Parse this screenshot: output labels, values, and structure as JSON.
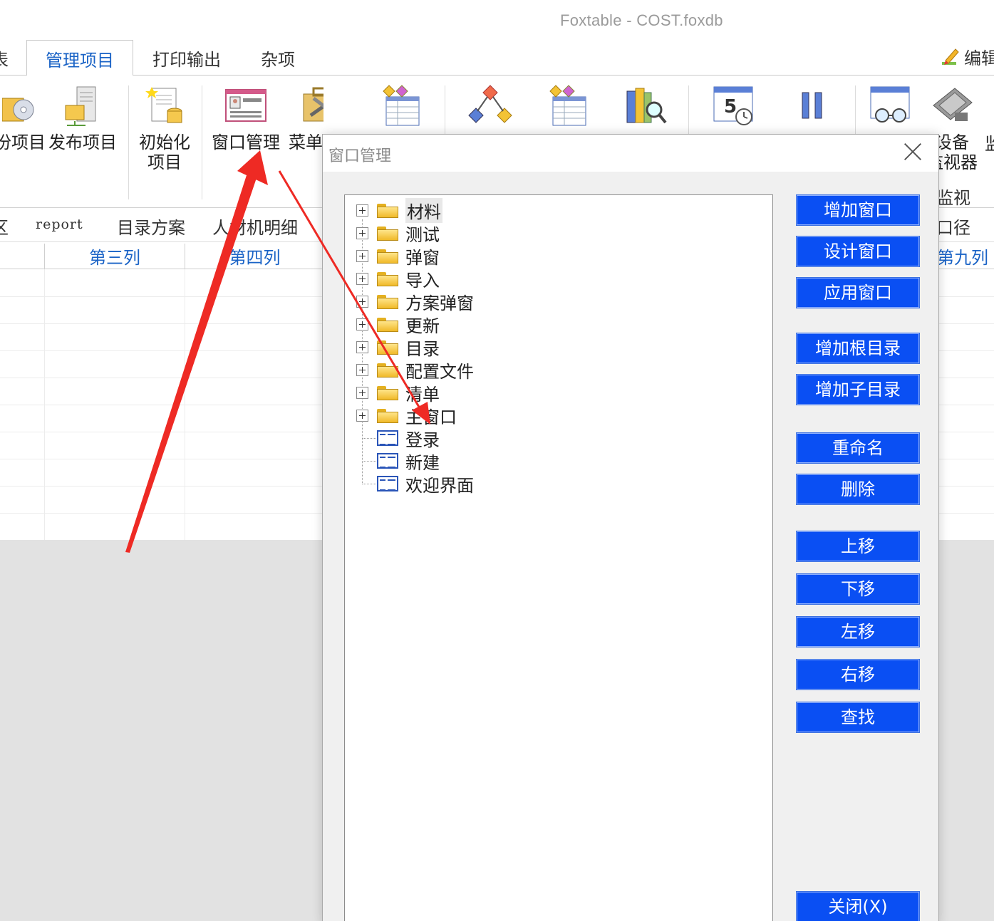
{
  "window": {
    "title": "Foxtable - COST.foxdb"
  },
  "tabs": {
    "partial_left": "表",
    "active": "管理项目",
    "print": "打印输出",
    "misc": "杂项",
    "edit": "编辑"
  },
  "ribbon": {
    "partial_project": "份项目",
    "publish": "发布项目",
    "init_line1": "初始化",
    "init_line2": "项目",
    "window_mgmt": "窗口管理",
    "menu_partial": "菜单",
    "device_line1": "设备",
    "device_line2": "监视器",
    "partial_right": "监",
    "group_label": "监视"
  },
  "subbar": {
    "partial_left": "区",
    "report": "report",
    "catalog_plan": "目录方案",
    "labor_detail": "人材机明细",
    "caliber": "口径"
  },
  "grid": {
    "col3": "第三列",
    "col4": "第四列",
    "col9": "第九列"
  },
  "dialog": {
    "title": "窗口管理",
    "tree": {
      "folders": [
        "材料",
        "测试",
        "弹窗",
        "导入",
        "方案弹窗",
        "更新",
        "目录",
        "配置文件",
        "清单",
        "主窗口"
      ],
      "windows": [
        "登录",
        "新建",
        "欢迎界面"
      ]
    },
    "buttons": {
      "add_window": "增加窗口",
      "design_window": "设计窗口",
      "apply_window": "应用窗口",
      "add_root": "增加根目录",
      "add_sub": "增加子目录",
      "rename": "重命名",
      "delete": "删除",
      "move_up": "上移",
      "move_down": "下移",
      "move_left": "左移",
      "move_right": "右移",
      "find": "查找",
      "close": "关闭(X)"
    }
  },
  "colors": {
    "button_blue": "#0a4ff3",
    "tab_blue": "#1a63c6",
    "annotation_red": "#ee2a24"
  }
}
